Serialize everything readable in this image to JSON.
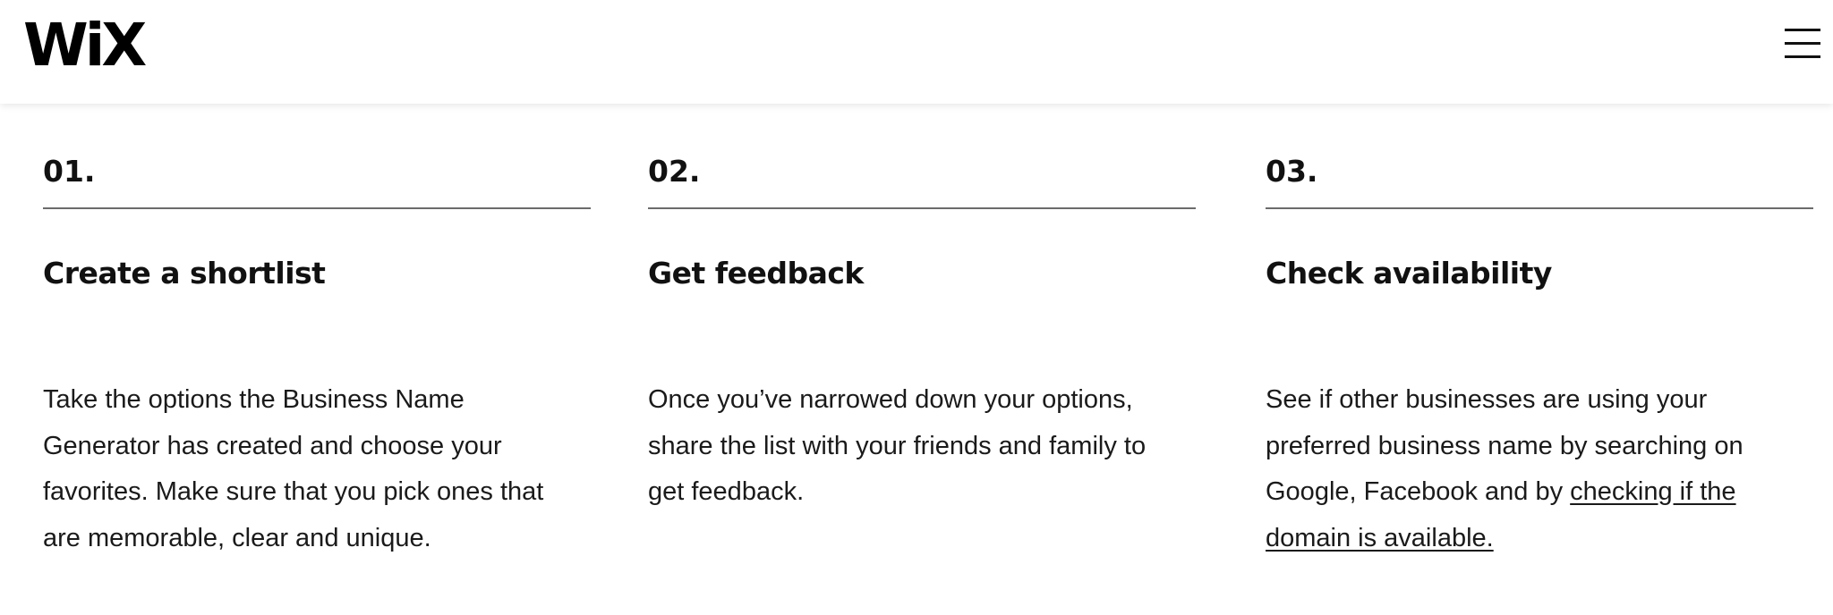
{
  "header": {
    "logo": "WiX",
    "menu_icon": "hamburger-menu-icon"
  },
  "steps": [
    {
      "number": "01.",
      "title": "Create a shortlist",
      "body": "Take the options the Business Name Generator has created and choose your favorites.  Make sure that you pick ones that are memorable, clear and unique."
    },
    {
      "number": "02.",
      "title": "Get feedback",
      "body": "Once you’ve narrowed down your options, share the list with your friends and family to get feedback."
    },
    {
      "number": "03.",
      "title": "Check availability",
      "body": "See if other businesses are using your preferred business name by searching on Google, Facebook and by ",
      "link_text": "checking if the domain is available."
    }
  ]
}
